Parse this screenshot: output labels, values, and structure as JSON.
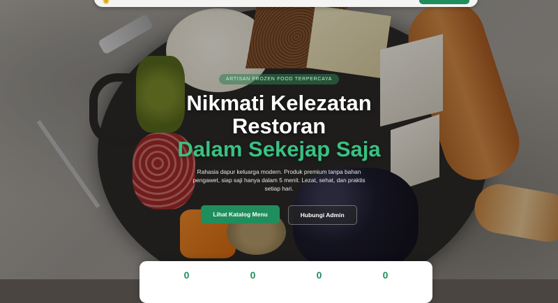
{
  "navbar": {
    "logo_icon": "sun-icon",
    "logo_glyph": "✺"
  },
  "hero": {
    "badge": "ARTISAN FROZEN FOOD TERPERCAYA",
    "title_line1": "Nikmati Kelezatan",
    "title_line2": "Restoran",
    "title_accent": "Dalam Sekejap Saja",
    "description": "Rahasia dapur keluarga modern. Produk premium tanpa bahan pengawet, siap saji hanya dalam 5 menit. Lezat, sehat, dan praktis setiap hari.",
    "primary_button": "Lihat Katalog Menu",
    "secondary_button": "Hubungi Admin"
  },
  "stats": [
    {
      "value": "0"
    },
    {
      "value": "0"
    },
    {
      "value": "0"
    },
    {
      "value": "0"
    }
  ],
  "colors": {
    "accent": "#39c181",
    "primary": "#1f8e5c"
  }
}
